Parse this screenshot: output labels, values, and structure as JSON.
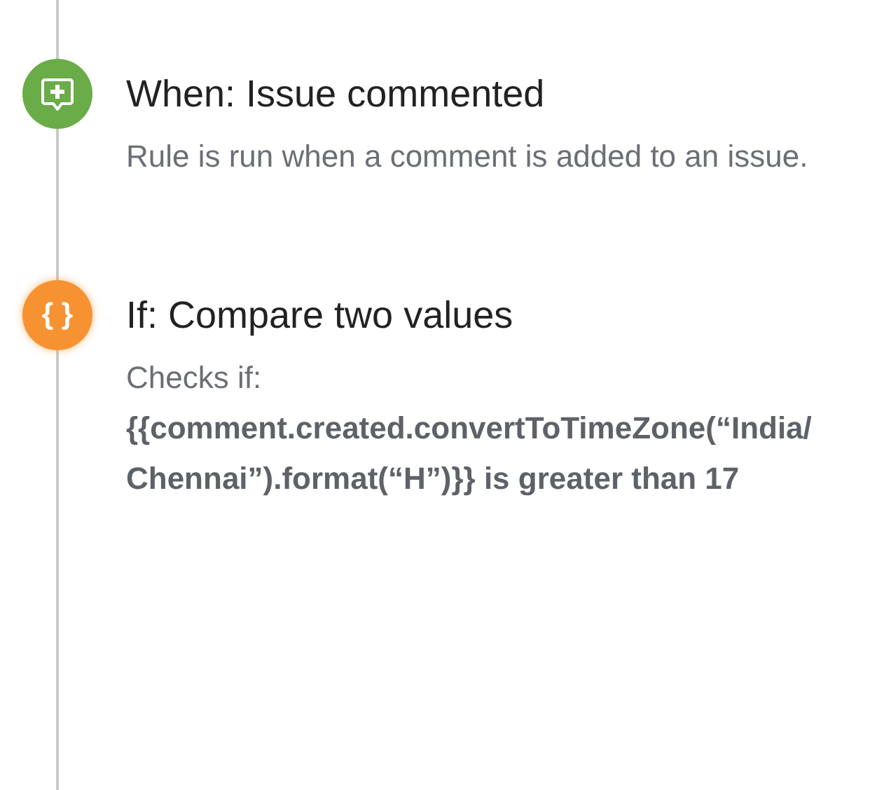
{
  "steps": [
    {
      "kind": "trigger",
      "color": "#6aac47",
      "title": "When: Issue commented",
      "description": "Rule is run when a comment is added to an issue."
    },
    {
      "kind": "condition",
      "color": "#f79232",
      "icon_text": "{ }",
      "title": "If: Compare two values",
      "description": "Checks if: **{{comment.created.convertToTimeZone(“India/Chennai”).format(“H”)}} is greater than 17**"
    }
  ]
}
